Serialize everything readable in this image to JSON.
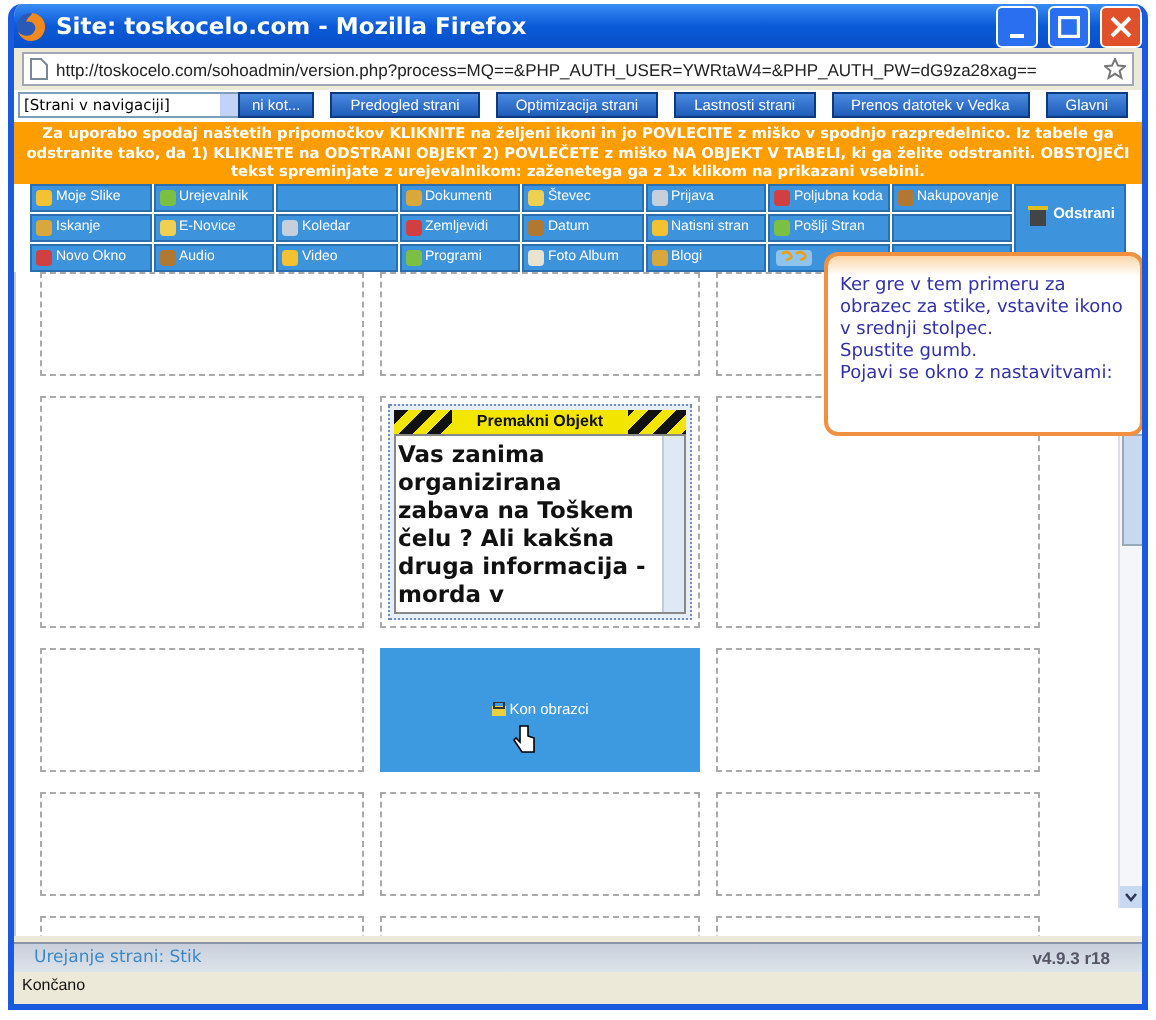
{
  "window": {
    "title": "Site: toskocelo.com - Mozilla Firefox",
    "url": "http://toskocelo.com/sohoadmin/version.php?process=MQ==&PHP_AUTH_USER=YWRtaW4=&PHP_AUTH_PW=dG9za28xag=="
  },
  "toolbar": {
    "page_select": "[Strani v navigaciji]",
    "buttons": [
      "ni kot...",
      "Predogled strani",
      "Optimizacija strani",
      "Lastnosti strani",
      "Prenos datotek v Vedka",
      "Glavni"
    ]
  },
  "banner": "Za uporabo spodaj naštetih pripomočkov KLIKNITE na željeni ikoni in jo POVLECITE z miško v spodnjo razpredelnico. Iz tabele ga odstranite tako, da 1) KLIKNETE na ODSTRANI OBJEKT 2) POVLEČETE z miško NA OBJEKT V TABELI, ki ga želite odstraniti. OBSTOJEČI tekst spreminjate z urejevalnikom: zaženetega ga z 1x klikom na prikazani vsebini.",
  "tools": {
    "remove": "Odstrani",
    "rows": [
      [
        {
          "kind": "tool",
          "label": "Moje Slike"
        },
        {
          "kind": "tool",
          "label": "Urejevalnik"
        },
        {
          "kind": "empty"
        },
        {
          "kind": "tool",
          "label": "Dokumenti"
        },
        {
          "kind": "tool",
          "label": "Števec"
        },
        {
          "kind": "tool",
          "label": "Prijava"
        },
        {
          "kind": "tool",
          "label": "Poljubna koda"
        },
        {
          "kind": "tool",
          "label": "Nakupovanje"
        }
      ],
      [
        {
          "kind": "tool",
          "label": "Iskanje"
        },
        {
          "kind": "tool",
          "label": "E-Novice"
        },
        {
          "kind": "tool",
          "label": "Koledar"
        },
        {
          "kind": "tool",
          "label": "Zemljevidi"
        },
        {
          "kind": "tool",
          "label": "Datum"
        },
        {
          "kind": "tool",
          "label": "Natisni stran"
        },
        {
          "kind": "tool",
          "label": "Pošlji Stran"
        },
        {
          "kind": "empty"
        }
      ],
      [
        {
          "kind": "tool",
          "label": "Novo Okno"
        },
        {
          "kind": "tool",
          "label": "Audio"
        },
        {
          "kind": "tool",
          "label": "Video"
        },
        {
          "kind": "tool",
          "label": "Programi"
        },
        {
          "kind": "tool",
          "label": "Foto Album"
        },
        {
          "kind": "tool",
          "label": "Blogi"
        },
        {
          "kind": "help"
        },
        {
          "kind": "empty"
        }
      ]
    ]
  },
  "canvas": {
    "rows": [
      [
        {
          "kind": "empty"
        },
        {
          "kind": "empty"
        },
        {
          "kind": "empty"
        }
      ],
      [
        {
          "kind": "empty"
        },
        {
          "kind": "widget",
          "title": "Premakni Objekt",
          "text": "Vas zanima organizirana zabava na Toškem čelu ? Ali kakšna druga informacija - morda v"
        },
        {
          "kind": "empty"
        }
      ],
      [
        {
          "kind": "empty"
        },
        {
          "kind": "placed",
          "label": "Kon obrazci"
        },
        {
          "kind": "empty"
        }
      ],
      [
        {
          "kind": "empty"
        },
        {
          "kind": "empty"
        },
        {
          "kind": "empty"
        }
      ],
      [
        {
          "kind": "empty"
        },
        {
          "kind": "empty"
        },
        {
          "kind": "empty"
        }
      ]
    ]
  },
  "tooltip": {
    "text": "Ker gre v tem primeru za obrazec za stike, vstavite ikono v srednji stolpec.\nSpustite gumb.\nPojavi se okno z nastavitvami:"
  },
  "status_bar": {
    "page": "Urejanje strani: Stik",
    "version": "v4.9.3 r18"
  },
  "browser_status": "Končano"
}
